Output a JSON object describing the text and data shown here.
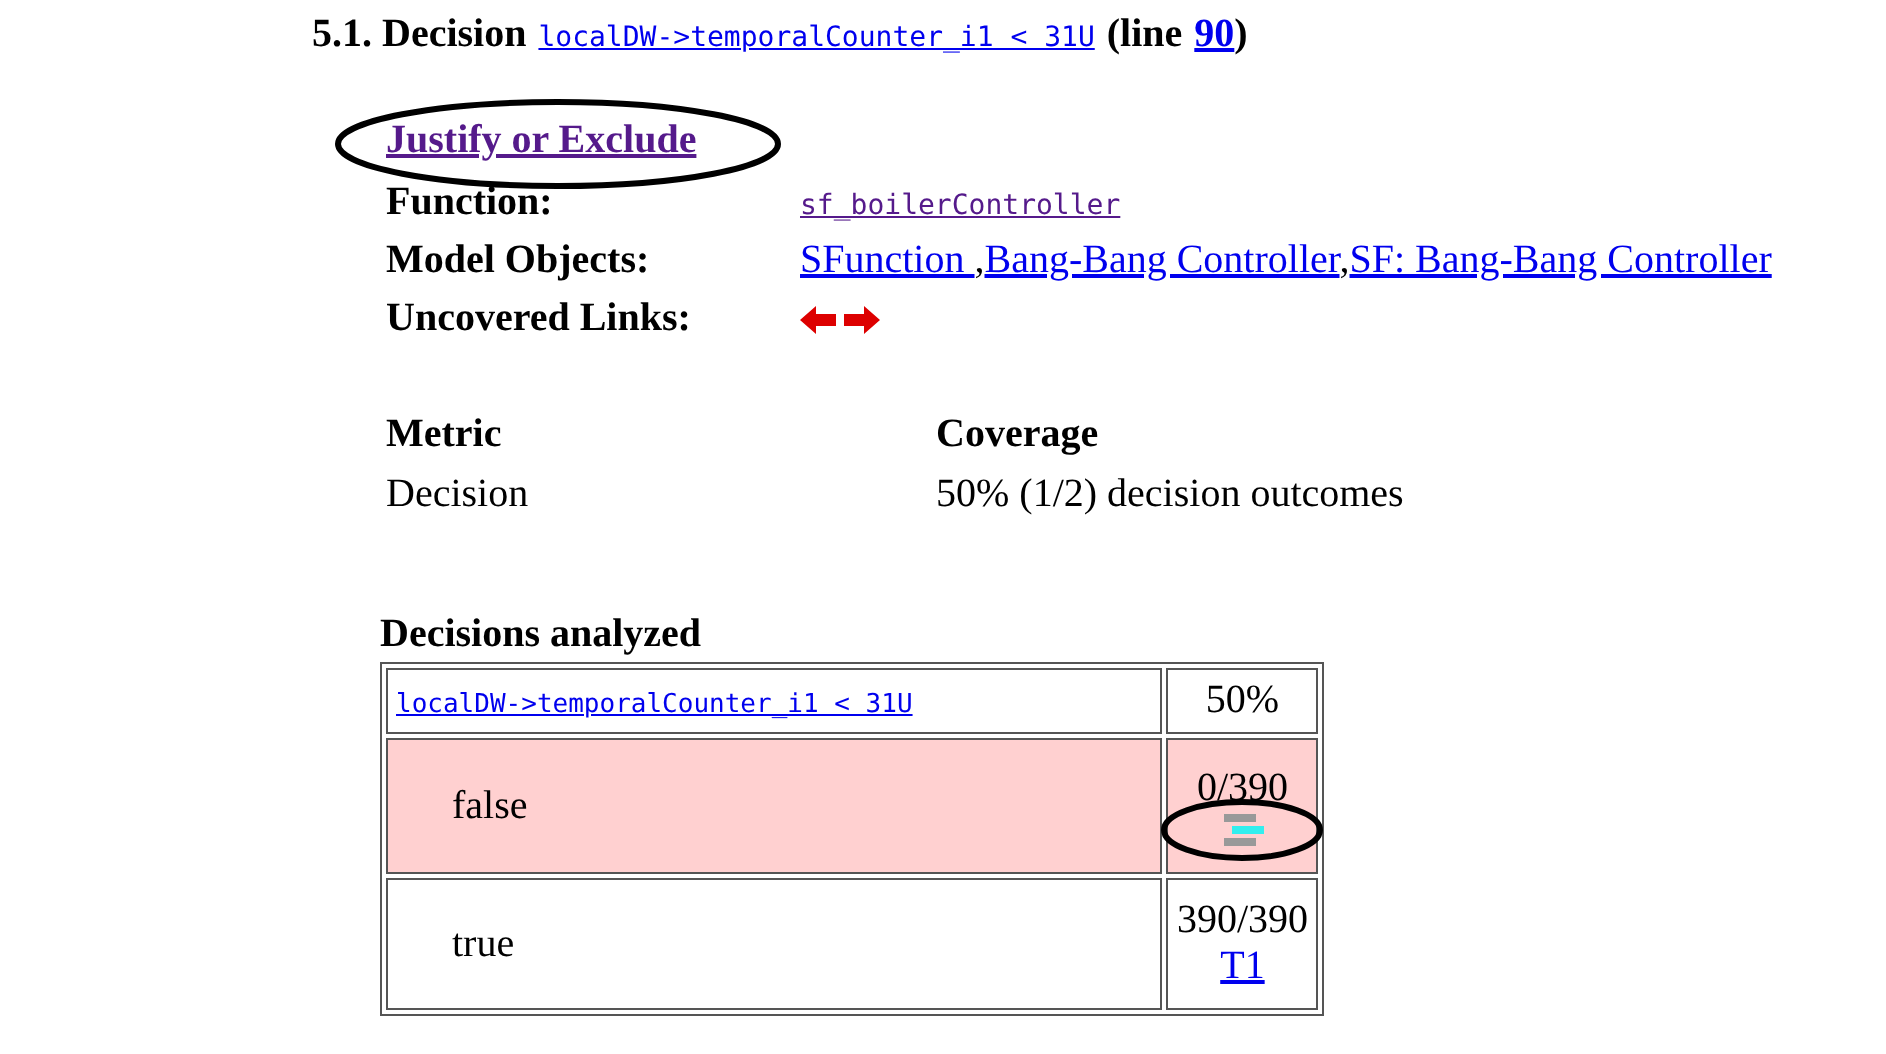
{
  "heading": {
    "title": "5.1. Decision",
    "expression": "localDW->temporalCounter_i1 < 31U",
    "line_prefix": "(line",
    "line": "90",
    "line_suffix": ")"
  },
  "justify_link": "Justify or Exclude",
  "details": [
    {
      "label": "Function:",
      "kind": "code",
      "links": [
        "sf_boilerController"
      ]
    },
    {
      "label": "Model Objects:",
      "kind": "links",
      "links": [
        "SFunction ",
        "Bang-Bang Controller",
        "SF: Bang-Bang Controller"
      ],
      "separators": [
        ",",
        ","
      ]
    },
    {
      "label": "Uncovered Links:",
      "kind": "arrows"
    }
  ],
  "metrics": {
    "columns": [
      "Metric",
      "Coverage"
    ],
    "rows": [
      [
        "Decision",
        "50% (1/2) decision outcomes"
      ]
    ]
  },
  "decisions": {
    "title": "Decisions analyzed",
    "expression": "localDW->temporalCounter_i1 < 31U",
    "total": "50%",
    "outcomes": [
      {
        "label": "false",
        "count": "0/390",
        "covered": false
      },
      {
        "label": "true",
        "count": "390/390",
        "covered": true,
        "link": "T1"
      }
    ]
  }
}
